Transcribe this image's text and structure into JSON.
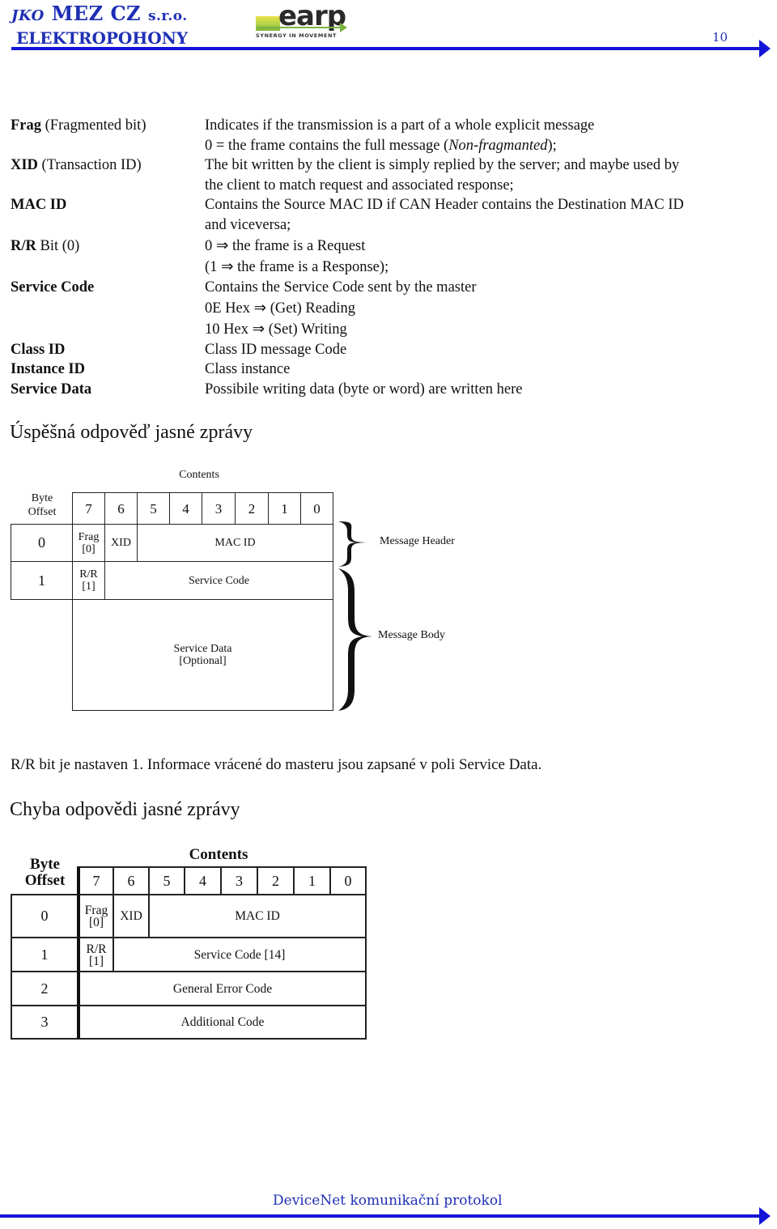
{
  "header": {
    "company_prefix": "JKO",
    "company_name": "MEZ CZ",
    "company_suffix": "s.r.o.",
    "company_subtitle": "ELEKTROPOHONY",
    "logo_word": "earp",
    "logo_tagline": "SYNERGY IN MOVEMENT",
    "page_number": "10",
    "accent_color": "#1414d8"
  },
  "definitions": [
    {
      "term_bold": "Frag",
      "term_rest": " (Fragmented bit)",
      "lines": [
        "Indicates if the transmission is a part  of a whole explicit message",
        "0 = the frame contains  the full message (",
        "Non-fragmanted",
        ");"
      ]
    },
    {
      "term_bold": "XID",
      "term_rest": " (Transaction ID)",
      "lines": [
        "The bit written by the client is simply replied by the server; and maybe used by",
        "the  client to match  request and associated  response;"
      ]
    },
    {
      "term_bold": "MAC ID",
      "term_rest": "",
      "lines": [
        "Contains the Source MAC ID if  CAN Header contains the Destination MAC ID",
        "and  viceversa;"
      ]
    },
    {
      "term_bold": "R/R",
      "term_rest": " Bit (0)",
      "lines": [
        "0 ⇒ the frame is a Request",
        "(1 ⇒ the frame is a Response);"
      ]
    },
    {
      "term_bold": "Service Code",
      "term_rest": "",
      "lines": [
        "Contains the  Service Code  sent by the master",
        "0E Hex ⇒ (Get) Reading",
        "10 Hex ⇒ (Set) Writing"
      ]
    },
    {
      "term_bold": "Class ID",
      "term_rest": "",
      "lines": [
        "Class ID message  Code"
      ]
    },
    {
      "term_bold": "Instance ID",
      "term_rest": "",
      "lines": [
        "Class instance"
      ]
    },
    {
      "term_bold": "Service Data",
      "term_rest": "",
      "lines": [
        "Possibile writing data (byte or word)  are written here"
      ]
    }
  ],
  "section1": {
    "title": "Úspěšná odpověď jasné zprávy",
    "diagram": {
      "contents_label": "Contents",
      "byte_offset_label_1": "Byte",
      "byte_offset_label_2": "Offset",
      "bits": [
        "7",
        "6",
        "5",
        "4",
        "3",
        "2",
        "1",
        "0"
      ],
      "rows": [
        {
          "offset": "0",
          "frag": "Frag",
          "frag_val": "[0]",
          "xid": "XID",
          "macid": "MAC ID"
        },
        {
          "offset": "1",
          "rr": "R/R",
          "rr_val": "[1]",
          "service_code": "Service Code"
        }
      ],
      "service_data_1": "Service Data",
      "service_data_2": "[Optional]",
      "brace_header": "Message Header",
      "brace_body": "Message Body"
    },
    "note": "R/R  bit  je nastaven  1. Informace vrácené do masteru jsou zapsané v poli  Service Data."
  },
  "section2": {
    "title": "Chyba odpovědi jasné zprávy",
    "diagram": {
      "contents_label": "Contents",
      "byte_offset_label_1": "Byte",
      "byte_offset_label_2": "Offset",
      "bits": [
        "7",
        "6",
        "5",
        "4",
        "3",
        "2",
        "1",
        "0"
      ],
      "rows": [
        {
          "offset": "0",
          "frag": "Frag",
          "frag_val": "[0]",
          "xid": "XID",
          "macid": "MAC ID"
        },
        {
          "offset": "1",
          "rr": "R/R",
          "rr_val": "[1]",
          "service_code": "Service Code [14]"
        },
        {
          "offset": "2",
          "content": "General Error Code"
        },
        {
          "offset": "3",
          "content": "Additional Code"
        }
      ]
    }
  },
  "footer": {
    "title": "DeviceNet komunikační protokol"
  }
}
